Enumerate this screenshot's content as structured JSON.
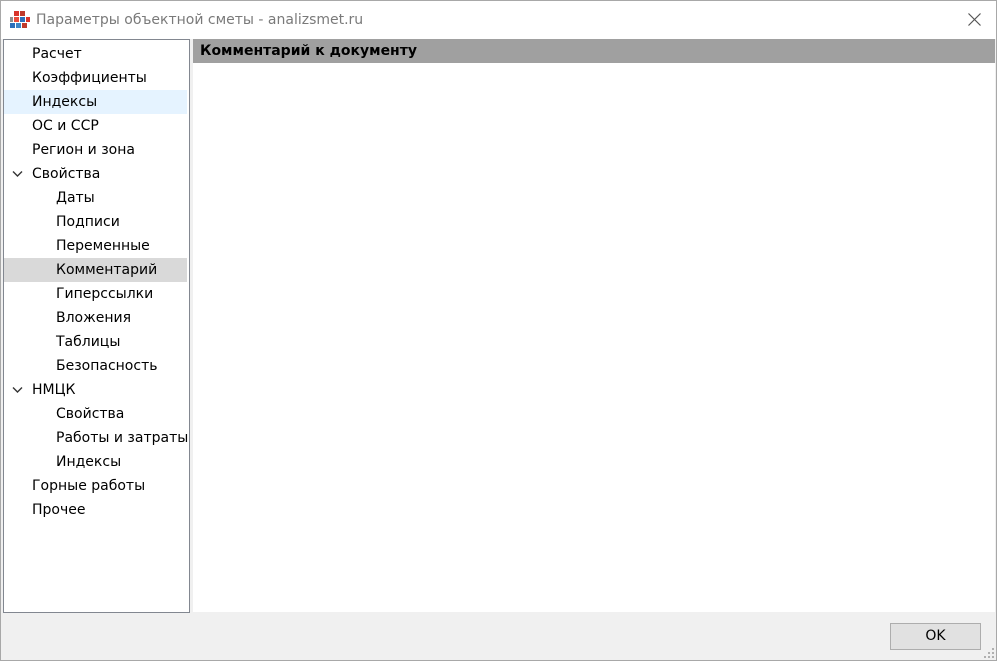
{
  "window": {
    "title": "Параметры объектной сметы - analizsmet.ru"
  },
  "tree": {
    "items": [
      {
        "label": "Расчет",
        "level": 0
      },
      {
        "label": "Коэффициенты",
        "level": 0
      },
      {
        "label": "Индексы",
        "level": 0,
        "state": "hover"
      },
      {
        "label": "ОС и ССР",
        "level": 0
      },
      {
        "label": "Регион и зона",
        "level": 0
      },
      {
        "label": "Свойства",
        "level": 0,
        "expanded": true
      },
      {
        "label": "Даты",
        "level": 1
      },
      {
        "label": "Подписи",
        "level": 1
      },
      {
        "label": "Переменные",
        "level": 1
      },
      {
        "label": "Комментарий",
        "level": 1,
        "state": "selected"
      },
      {
        "label": "Гиперссылки",
        "level": 1
      },
      {
        "label": "Вложения",
        "level": 1
      },
      {
        "label": "Таблицы",
        "level": 1
      },
      {
        "label": "Безопасность",
        "level": 1
      },
      {
        "label": "НМЦК",
        "level": 0,
        "expanded": true
      },
      {
        "label": "Свойства",
        "level": 1
      },
      {
        "label": "Работы и затраты",
        "level": 1
      },
      {
        "label": "Индексы",
        "level": 1
      },
      {
        "label": "Горные работы",
        "level": 0
      },
      {
        "label": "Прочее",
        "level": 0
      }
    ]
  },
  "content": {
    "header": "Комментарий к документу"
  },
  "footer": {
    "ok_label": "OK"
  },
  "colors": {
    "header_bg": "#a0a0a0",
    "selected_bg": "#d9d9d9",
    "hover_bg": "#e5f3ff"
  }
}
